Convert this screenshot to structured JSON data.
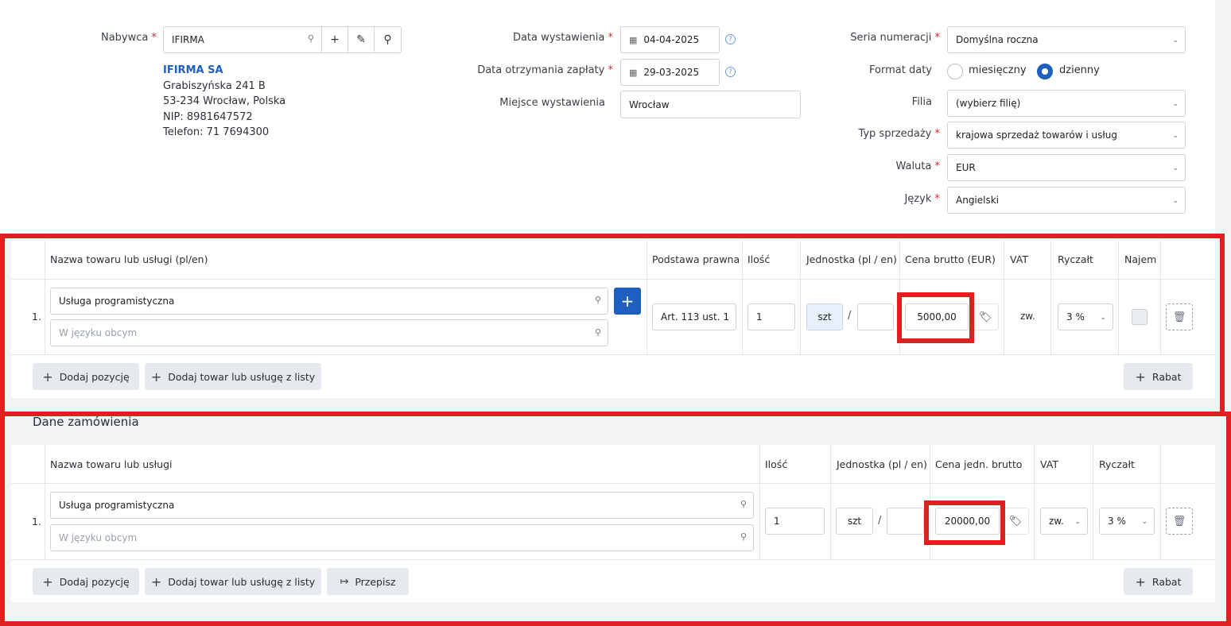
{
  "header": {
    "buyer_label": "Nabywca",
    "buyer_value": "IFIRMA",
    "buyer_name": "IFIRMA SA",
    "buyer_addr1": "Grabiszyńska 241 B",
    "buyer_addr2": "53-234 Wrocław, Polska",
    "buyer_nip": "NIP: 8981647572",
    "buyer_phone": "Telefon: 71 7694300",
    "issue_date_label": "Data wystawienia",
    "issue_date": "04-04-2025",
    "payment_date_label": "Data otrzymania zapłaty",
    "payment_date": "29-03-2025",
    "place_label": "Miejsce wystawienia",
    "place": "Wrocław",
    "series_label": "Seria numeracji",
    "series": "Domyślna roczna",
    "date_format_label": "Format daty",
    "date_format_monthly": "miesięczny",
    "date_format_daily": "dzienny",
    "branch_label": "Filia",
    "branch": "(wybierz filię)",
    "sale_type_label": "Typ sprzedaży",
    "sale_type": "krajowa sprzedaż towarów i usług",
    "currency_label": "Waluta",
    "currency": "EUR",
    "language_label": "Język",
    "language": "Angielski",
    "required_mark": "*",
    "help_glyph": "?"
  },
  "items": {
    "columns": {
      "name": "Nazwa towaru lub usługi (pl/en)",
      "legal": "Podstawa prawna",
      "qty": "Ilość",
      "unit": "Jednostka (pl / en)",
      "price": "Cena brutto (EUR)",
      "vat": "VAT",
      "flat": "Ryczałt",
      "rent": "Najem"
    },
    "row": {
      "index": "1.",
      "name": "Usługa programistyczna",
      "name_foreign_placeholder": "W języku obcym",
      "legal": "Art. 113 ust. 1",
      "qty": "1",
      "unit": "szt",
      "unit_sep": "/",
      "price": "5000,00",
      "vat": "zw.",
      "flat": "3 %"
    },
    "add_position": "Dodaj pozycję",
    "add_from_list": "Dodaj towar lub usługę z listy",
    "discount": "Rabat"
  },
  "order": {
    "title": "Dane zamówienia",
    "columns": {
      "name": "Nazwa towaru lub usługi",
      "qty": "Ilość",
      "unit": "Jednostka (pl / en)",
      "price": "Cena jedn. brutto",
      "vat": "VAT",
      "flat": "Ryczałt"
    },
    "row": {
      "index": "1.",
      "name": "Usługa programistyczna",
      "name_foreign_placeholder": "W języku obcym",
      "qty": "1",
      "unit": "szt",
      "unit_sep": "/",
      "price": "20000,00",
      "vat": "zw.",
      "flat": "3 %"
    },
    "add_position": "Dodaj pozycję",
    "add_from_list": "Dodaj towar lub usługę z listy",
    "copy": "Przepisz",
    "discount": "Rabat"
  },
  "colors": {
    "accent": "#1f5fbf",
    "highlight": "#e0201f"
  }
}
